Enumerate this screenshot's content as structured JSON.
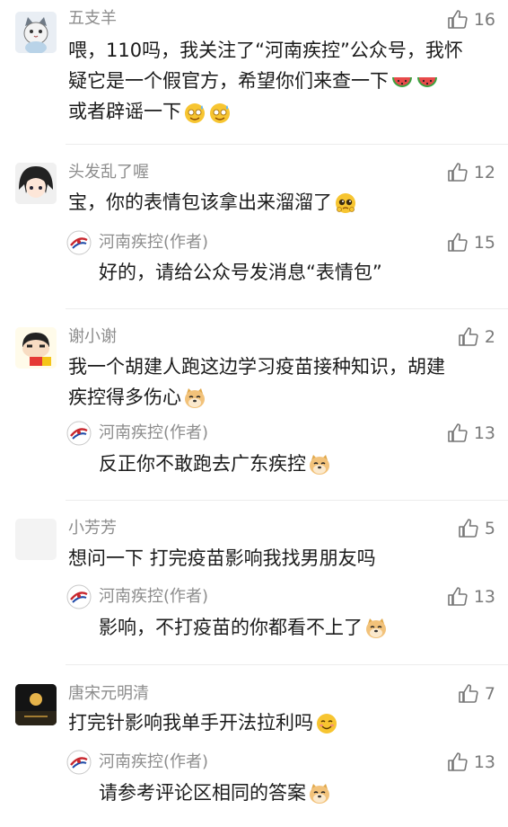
{
  "comments": [
    {
      "user": "五支羊",
      "likes": "16",
      "lines": [
        "喂，110吗，我关注了“河南疾控”公众号，我怀",
        "疑它是一个假官方，希望你们来查一下",
        "或者辟谣一下"
      ],
      "reply": null
    },
    {
      "user": "头发乱了喔",
      "likes": "12",
      "lines": [
        "宝，你的表情包该拿出来溜溜了"
      ],
      "reply": {
        "user": "河南疾控",
        "tag": "(作者)",
        "likes": "15",
        "text": "好的，请给公众号发消息“表情包”"
      }
    },
    {
      "user": "谢小谢",
      "likes": "2",
      "lines": [
        "我一个胡建人跑这边学习疫苗接种知识，胡建",
        "疾控得多伤心"
      ],
      "reply": {
        "user": "河南疾控",
        "tag": "(作者)",
        "likes": "13",
        "text": "反正你不敢跑去广东疾控"
      }
    },
    {
      "user": "小芳芳",
      "likes": "5",
      "lines": [
        "想问一下 打完疫苗影响我找男朋友吗"
      ],
      "reply": {
        "user": "河南疾控",
        "tag": "(作者)",
        "likes": "13",
        "text": "影响，不打疫苗的你都看不上了"
      }
    },
    {
      "user": "唐宋元明清",
      "likes": "7",
      "lines": [
        "打完针影响我单手开法拉利吗"
      ],
      "reply": {
        "user": "河南疾控",
        "tag": "(作者)",
        "likes": "13",
        "text": "请参考评论区相同的答案"
      }
    }
  ],
  "icons": {
    "like": "thumbs-up-icon",
    "watermelon": "watermelon-emoji",
    "sweat": "sweat-smile-emoji",
    "pleading": "pleading-emoji",
    "doge": "doge-emoji",
    "smile": "blush-emoji"
  },
  "colors": {
    "name": "#8d8d8d",
    "text": "#1b1b1b",
    "like": "#7a7a7a"
  }
}
